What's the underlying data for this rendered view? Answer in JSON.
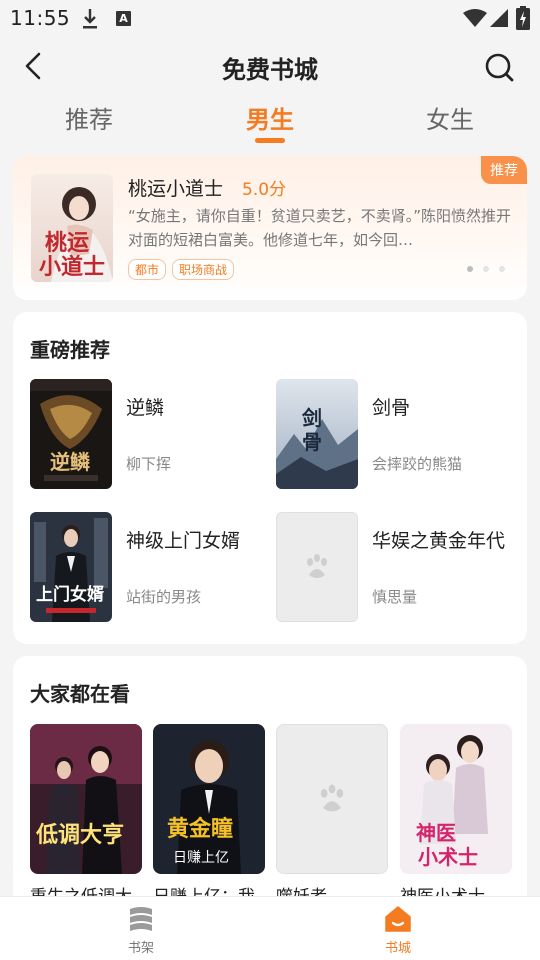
{
  "status_bar": {
    "time": "11:55"
  },
  "header": {
    "title": "免费书城"
  },
  "tabs": [
    {
      "label": "推荐",
      "active": false
    },
    {
      "label": "男生",
      "active": true
    },
    {
      "label": "女生",
      "active": false
    }
  ],
  "featured": {
    "badge": "推荐",
    "title": "桃运小道士",
    "score": "5.0分",
    "description": "“女施主，请你自重！贫道只卖艺，不卖肾。”陈阳愤然推开对面的短裙白富美。他修道七年，如今回…",
    "tags": [
      "都市",
      "职场商战"
    ],
    "cover_text": "桃运小道士",
    "pager_active_index": 0
  },
  "heavy_recommend": {
    "title": "重磅推荐",
    "books": [
      {
        "title": "逆鳞",
        "author": "柳下挥",
        "cover_text": "逆鳞"
      },
      {
        "title": "剑骨",
        "author": "会摔跤的熊猫",
        "cover_text": "剑骨"
      },
      {
        "title": "神级上门女婿",
        "author": "站街的男孩",
        "cover_text": "上门女婿"
      },
      {
        "title": "华娱之黄金年代",
        "author": "慎思量",
        "cover_text": ""
      }
    ]
  },
  "popular": {
    "title": "大家都在看",
    "books": [
      {
        "title": "重生之低调大",
        "cover_text": "低调大亨"
      },
      {
        "title": "日赚上亿：我",
        "cover_text": "黄金瞳"
      },
      {
        "title": "噬妖者",
        "cover_text": ""
      },
      {
        "title": "神医小术士",
        "cover_text": "神医小术士"
      }
    ]
  },
  "bottom_nav": [
    {
      "label": "书架",
      "icon": "bookshelf-icon",
      "active": false
    },
    {
      "label": "书城",
      "icon": "home-icon",
      "active": true
    }
  ],
  "colors": {
    "accent": "#f47b20",
    "background": "#f4f4f4"
  }
}
